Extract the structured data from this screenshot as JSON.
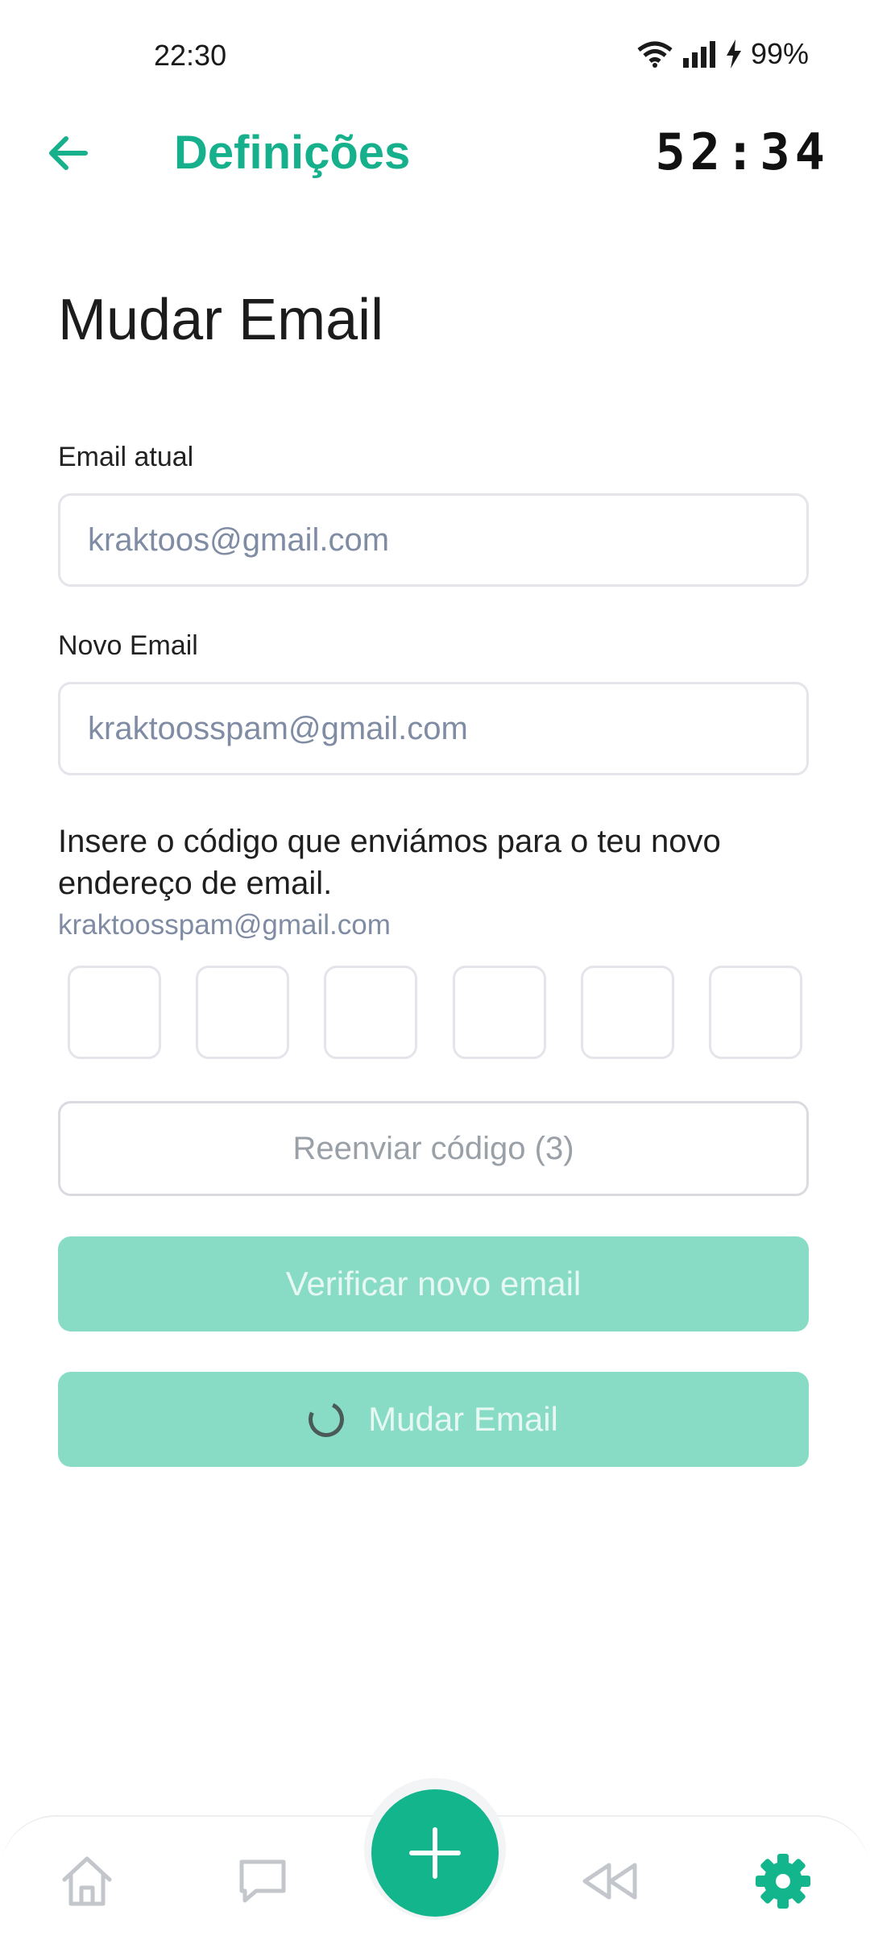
{
  "status_bar": {
    "time": "22:30",
    "battery": "99%"
  },
  "header": {
    "title": "Definições",
    "timer": "52:34"
  },
  "page": {
    "title": "Mudar Email"
  },
  "current_email": {
    "label": "Email atual",
    "value": "kraktoos@gmail.com"
  },
  "new_email": {
    "label": "Novo Email",
    "value": "kraktoosspam@gmail.com"
  },
  "verification": {
    "instruction": "Insere o código que enviámos para o teu novo endereço de email.",
    "email": "kraktoosspam@gmail.com",
    "code_digits": [
      "",
      "",
      "",
      "",
      "",
      ""
    ]
  },
  "buttons": {
    "resend": "Reenviar código (3)",
    "verify": "Verificar novo email",
    "change": "Mudar Email"
  },
  "nav": {
    "items": [
      "home-icon",
      "chat-icon",
      "add-icon",
      "rewind-icon",
      "settings-icon"
    ],
    "active": "settings-icon"
  },
  "colors": {
    "accent": "#16b08c",
    "button_disabled": "#88dbc5",
    "muted_text": "#7f8ca3"
  }
}
